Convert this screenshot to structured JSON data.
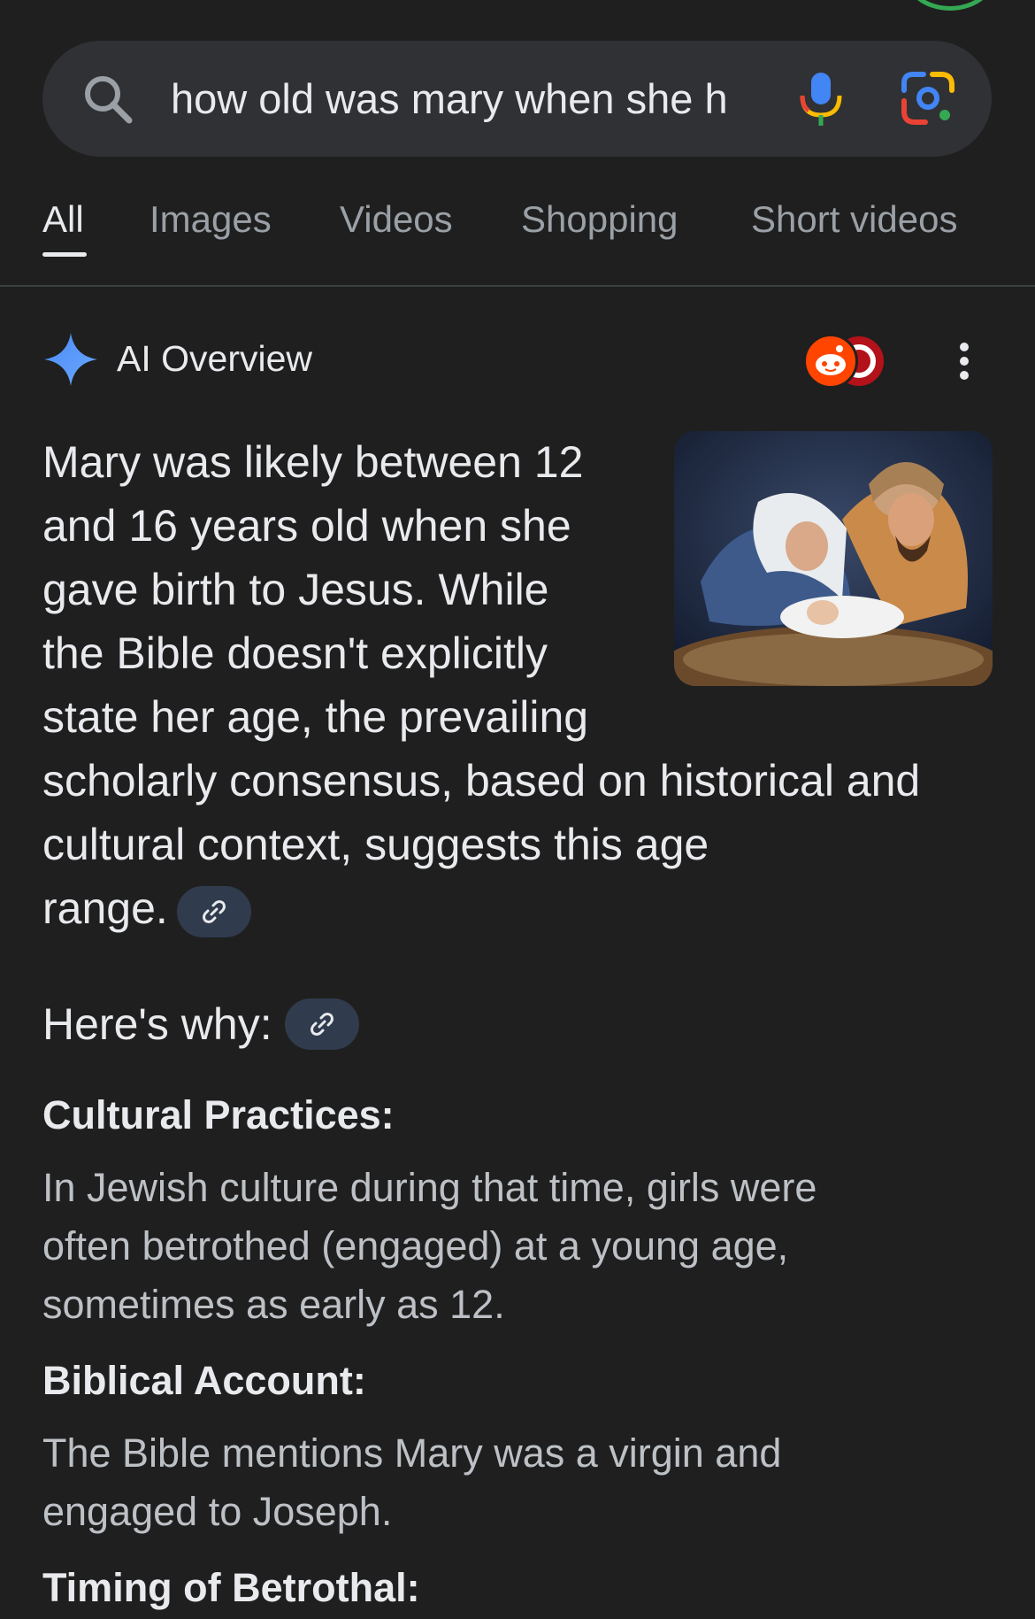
{
  "search": {
    "query": "how old was mary when she h",
    "icons": {
      "search": "search-icon",
      "voice": "microphone-icon",
      "lens": "google-lens-icon"
    }
  },
  "tabs": [
    {
      "label": "All",
      "active": true
    },
    {
      "label": "Images",
      "active": false
    },
    {
      "label": "Videos",
      "active": false
    },
    {
      "label": "Shopping",
      "active": false
    },
    {
      "label": "Short videos",
      "active": false
    }
  ],
  "ai_overview": {
    "title": "AI Overview",
    "sources": [
      "reddit-icon",
      "source-icon"
    ],
    "summary_lines": [
      "Mary was likely between 12",
      "and 16 years old when she",
      "gave birth to Jesus. While",
      "the Bible doesn't explicitly",
      "state her age, the prevailing",
      "scholarly consensus, based on historical and",
      "cultural context, suggests this age",
      "range."
    ],
    "why_heading": "Here's why:",
    "sections": [
      {
        "heading": "Cultural Practices:",
        "body_lines": [
          "In Jewish culture during that time, girls were",
          "often betrothed (engaged) at a young age,",
          "sometimes as early as 12."
        ]
      },
      {
        "heading": "Biblical Account:",
        "body_lines": [
          "The Bible mentions Mary was a virgin and",
          "engaged to Joseph."
        ]
      },
      {
        "heading": "Timing of Betrothal:",
        "body_lines": []
      }
    ]
  },
  "colors": {
    "background": "#1f1f1f",
    "search_bar": "#303134",
    "chip": "#303b4d",
    "spark": "#4c8bf5",
    "reddit": "#ff4500"
  }
}
